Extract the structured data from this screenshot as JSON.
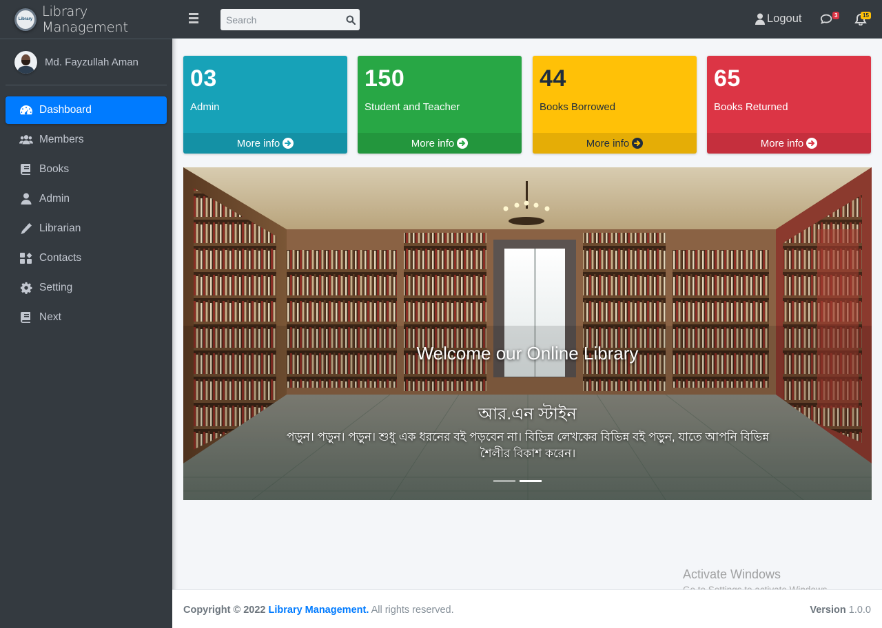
{
  "brand": {
    "name": "Library Management",
    "logo_text": "Library"
  },
  "user": {
    "name": "Md. Fayzullah Aman"
  },
  "sidebar": {
    "items": [
      {
        "label": "Dashboard",
        "icon": "tachometer-icon",
        "active": true
      },
      {
        "label": "Members",
        "icon": "users-icon"
      },
      {
        "label": "Books",
        "icon": "book-icon"
      },
      {
        "label": "Admin",
        "icon": "user-icon"
      },
      {
        "label": "Librarian",
        "icon": "pencil-icon"
      },
      {
        "label": "Contacts",
        "icon": "address-book-icon"
      },
      {
        "label": "Setting",
        "icon": "gear-icon"
      },
      {
        "label": "Next",
        "icon": "book-icon"
      }
    ]
  },
  "topbar": {
    "search_placeholder": "Search",
    "logout_label": "Logout",
    "messages_badge": "3",
    "notifications_badge": "15"
  },
  "stats": [
    {
      "value": "03",
      "label": "Admin",
      "footer": "More info",
      "color": "#17a2b8"
    },
    {
      "value": "150",
      "label": "Student and Teacher",
      "footer": "More info",
      "color": "#28a745"
    },
    {
      "value": "44",
      "label": "Books Borrowed",
      "footer": "More info",
      "color": "#ffc107"
    },
    {
      "value": "65",
      "label": "Books Returned",
      "footer": "More info",
      "color": "#dc3545"
    }
  ],
  "carousel": {
    "title": "Welcome our Online Library",
    "subtitle": "আর.এন স্টাইন",
    "text": "পড়ুন। পড়ুন। পড়ুন। শুধু এক ধরনের বই পড়বেন না। বিভিন্ন লেখকের বিভিন্ন বই পড়ুন, যাতে আপনি বিভিন্ন শৈলীর বিকাশ করেন।",
    "slides": 2,
    "active_slide": 2
  },
  "watermark": {
    "line1": "Activate Windows",
    "line2": "Go to Settings to activate Windows."
  },
  "footer": {
    "copyright_prefix": "Copyright © 2022",
    "brand_link": "Library Management.",
    "rights": "All rights reserved.",
    "version_label": "Version",
    "version_value": "1.0.0"
  }
}
